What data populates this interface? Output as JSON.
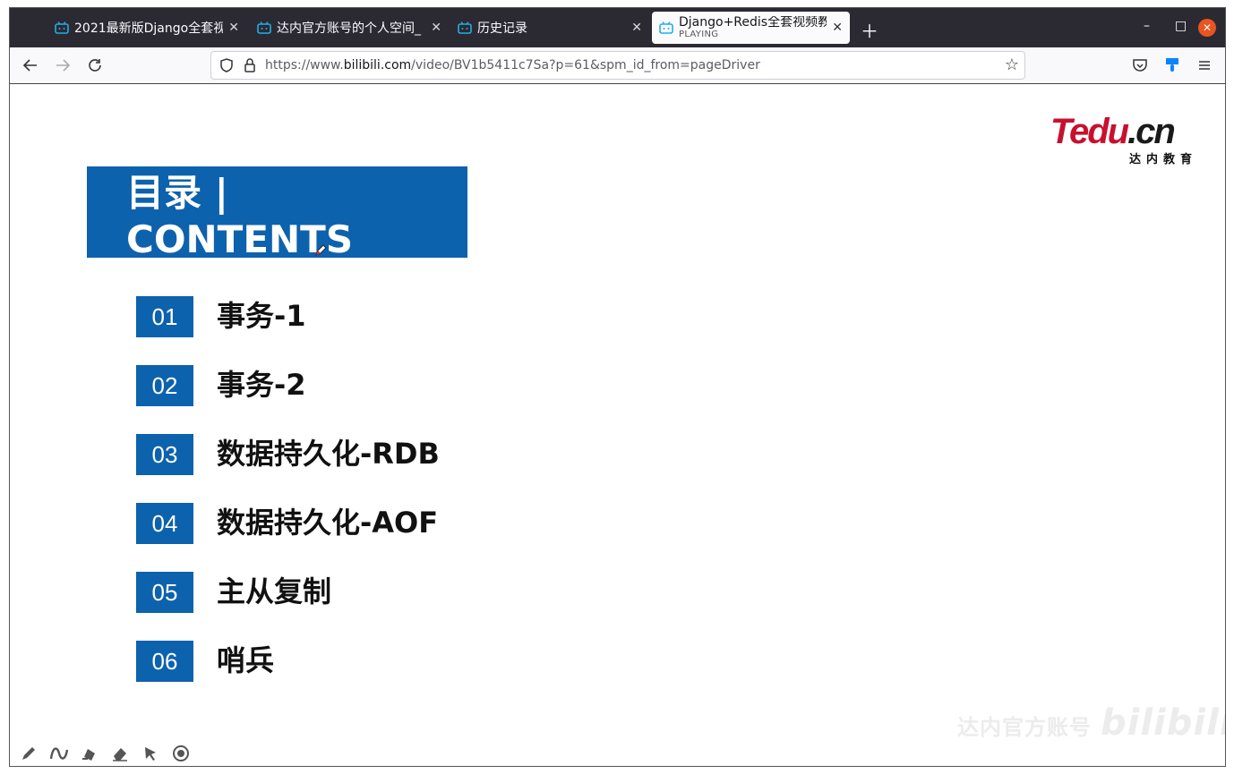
{
  "tabs": [
    {
      "title": "2021最新版Django全套视"
    },
    {
      "title": "达内官方账号的个人空间_"
    },
    {
      "title": "历史记录"
    },
    {
      "title": "Django+Redis全套视频教",
      "subtitle": "PLAYING",
      "active": true
    }
  ],
  "address_bar": {
    "url_prefix": "https://www.",
    "url_domain": "bilibili.com",
    "url_suffix": "/video/BV1b5411c7Sa?p=61&spm_id_from=pageDriver"
  },
  "slide": {
    "logo_text_main": "Tedu",
    "logo_text_suffix": ".cn",
    "logo_subtitle": "达内教育",
    "banner_title": "目录 | CONTENTS",
    "items": [
      {
        "num": "01",
        "label": "事务-1"
      },
      {
        "num": "02",
        "label": "事务-2"
      },
      {
        "num": "03",
        "label": "数据持久化-RDB"
      },
      {
        "num": "04",
        "label": "数据持久化-AOF"
      },
      {
        "num": "05",
        "label": "主从复制"
      },
      {
        "num": "06",
        "label": "哨兵"
      }
    ]
  },
  "watermark": {
    "text": "达内官方账号",
    "brand": "bilibili"
  },
  "colors": {
    "accent": "#0d62ad",
    "logo_red": "#c8102e",
    "tab_bg": "#2b2a33",
    "close_btn": "#e95420"
  }
}
